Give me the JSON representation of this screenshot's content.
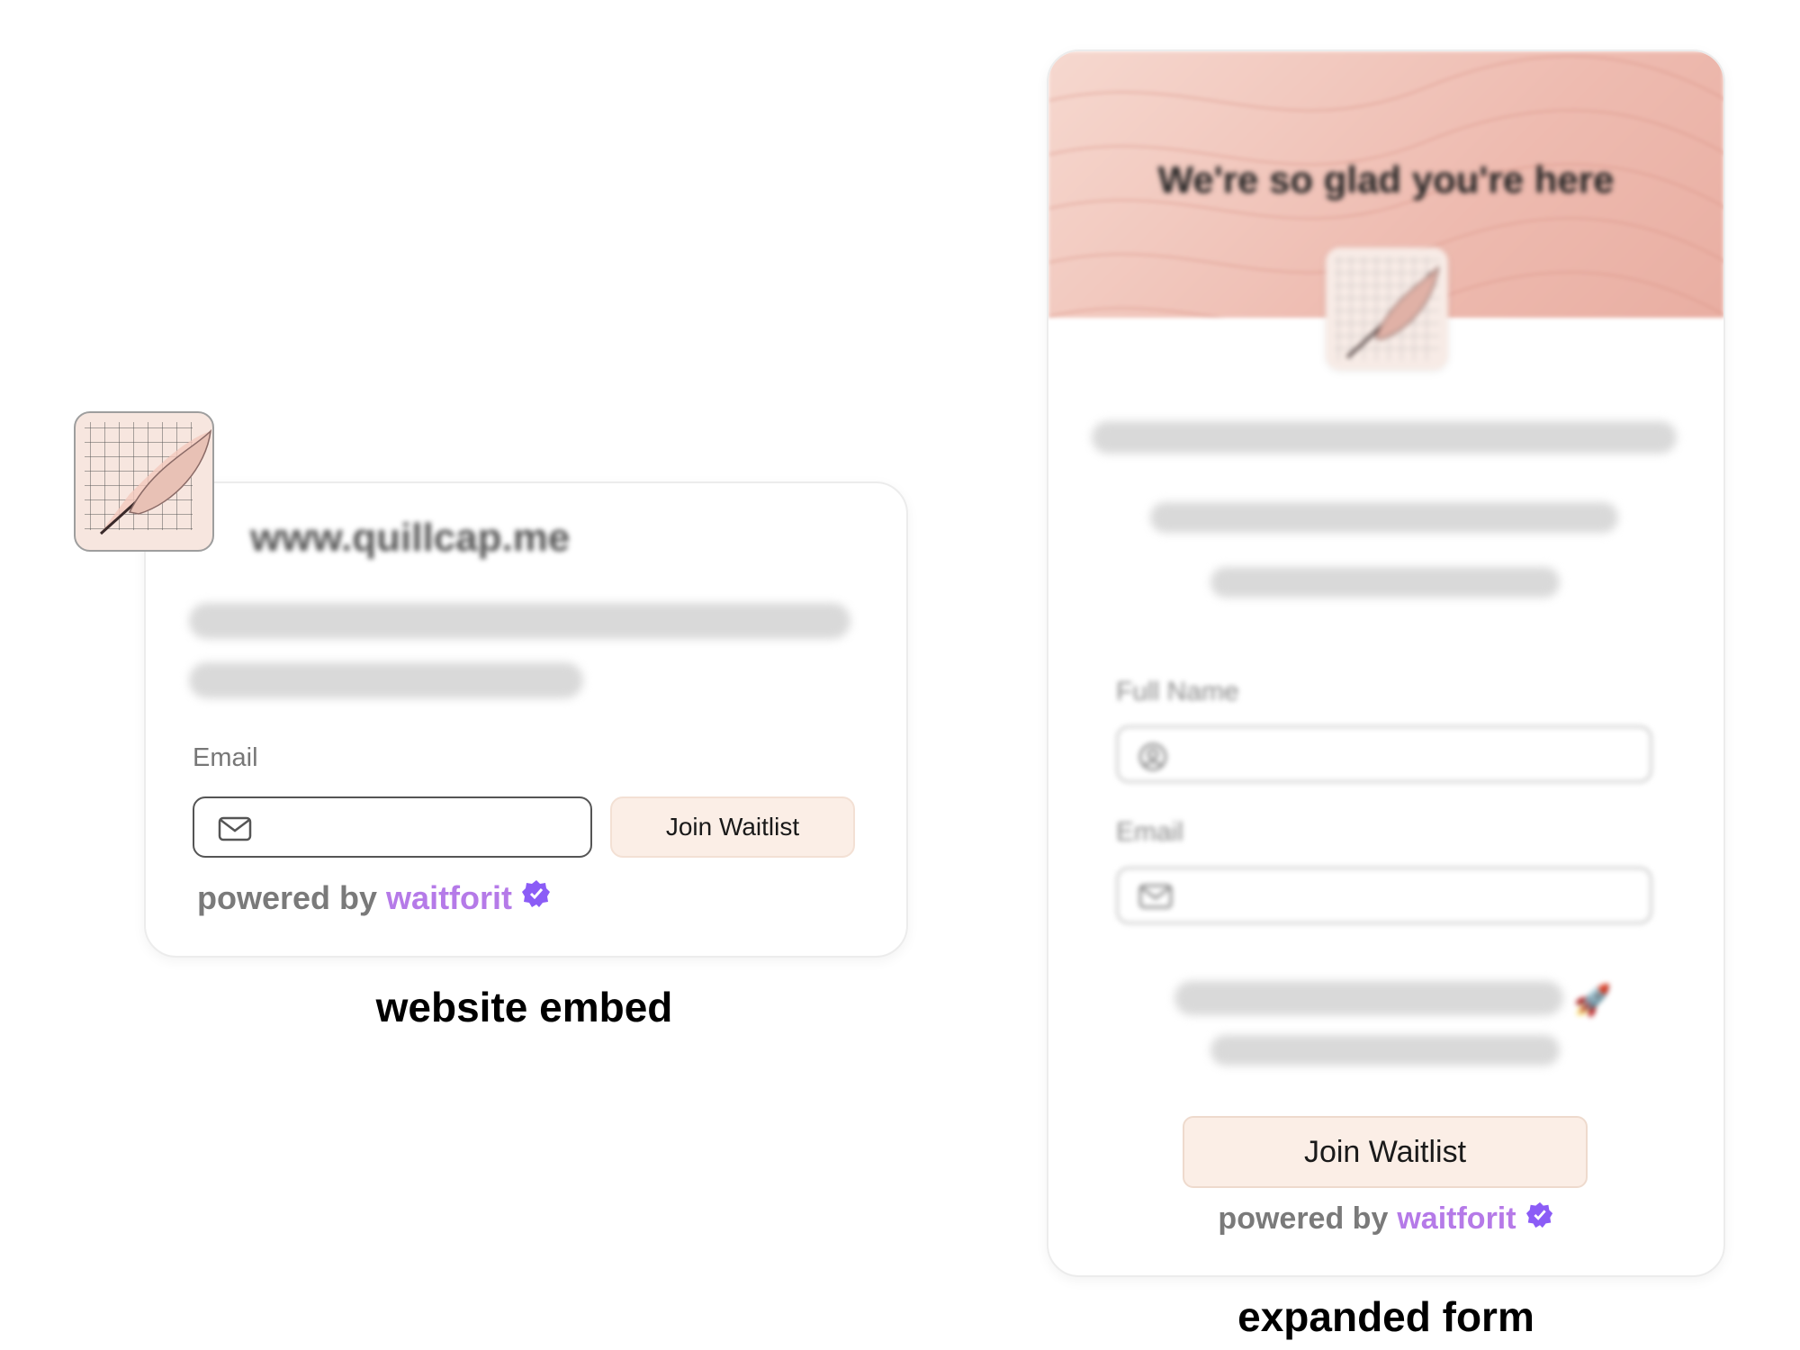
{
  "embed": {
    "url": "www.quillcap.me",
    "email_label": "Email",
    "join_label": "Join Waitlist",
    "powered_prefix": "powered by",
    "powered_brand": "waitforit",
    "caption": "website embed"
  },
  "form": {
    "title": "We're so glad you're here",
    "full_name_label": "Full Name",
    "email_label": "Email",
    "join_label": "Join Waitlist",
    "powered_prefix": "powered by",
    "powered_brand": "waitforit",
    "caption": "expanded form"
  },
  "icons": {
    "logo": "quill-logo-icon",
    "mail": "mail-icon",
    "user": "user-icon",
    "verified": "verified-badge-icon",
    "rocket": "rocket-icon"
  },
  "colors": {
    "brand": "#b57ae8",
    "verified": "#8b5cf6",
    "button_bg": "#fbeee6",
    "banner": "#eebbb0"
  }
}
